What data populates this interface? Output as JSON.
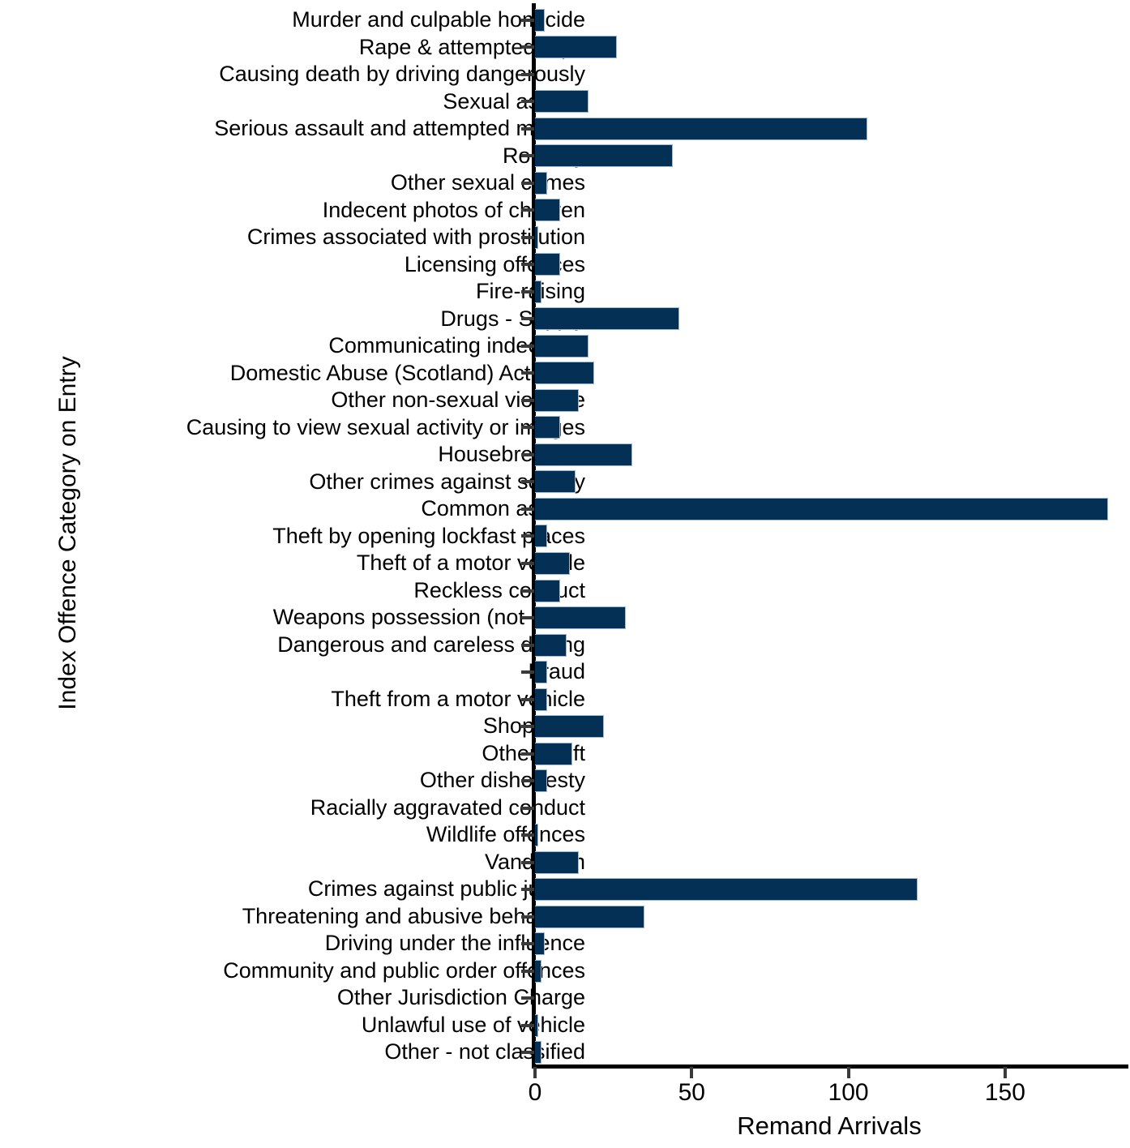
{
  "chart_data": {
    "type": "bar",
    "orientation": "horizontal",
    "title": "",
    "xlabel": "Remand Arrivals",
    "ylabel": "Index Offence Category on Entry",
    "xlim": [
      0,
      187.8
    ],
    "xticks": [
      0,
      50,
      100,
      150
    ],
    "xticklabels": [
      "0",
      "50",
      "100",
      "150"
    ],
    "grid": false,
    "legend": null,
    "bar_color": "#053056",
    "bar_edge_color": "#9dbcd4",
    "categories": [
      "Murder and culpable homicide",
      "Rape & attempted rape",
      "Causing death by driving dangerously",
      "Sexual assault",
      "Serious assault and attempted murder",
      "Robbery",
      "Other sexual crimes",
      "Indecent photos of children",
      "Crimes associated with prostitution",
      "Licensing offences",
      "Fire-raising",
      "Drugs - Supply",
      "Communicating indecently",
      "Domestic Abuse (Scotland) Act 2018",
      "Other non-sexual violence",
      "Causing to view sexual activity or images",
      "Housebreaking",
      "Other crimes against society",
      "Common assault",
      "Theft by opening lockfast places",
      "Theft of a motor vehicle",
      "Reckless conduct",
      "Weapons possession (not used)",
      "Dangerous and careless driving",
      "Fraud",
      "Theft from a motor vehicle",
      "Shoplifting",
      "Other theft",
      "Other dishonesty",
      "Racially aggravated conduct",
      "Wildlife offences",
      "Vandalism",
      "Crimes against public justice",
      "Threatening and abusive behaviour",
      "Driving under the influence",
      "Community and public order offences",
      "Other Jurisdiction Charge",
      "Unlawful use of vehicle",
      "Other - not classified"
    ],
    "values": [
      3,
      26,
      0,
      17,
      106,
      44,
      4,
      8,
      1,
      8,
      2,
      46,
      17,
      19,
      14,
      8,
      31,
      13,
      183,
      4,
      11,
      8,
      29,
      10,
      4,
      4,
      22,
      12,
      4,
      0,
      1,
      14,
      122,
      35,
      3,
      2,
      0,
      1,
      2
    ]
  }
}
